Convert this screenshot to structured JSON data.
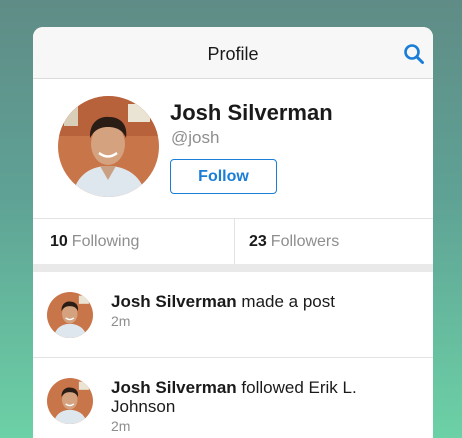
{
  "header": {
    "title": "Profile",
    "search_icon": "search-icon"
  },
  "profile": {
    "name": "Josh Silverman",
    "handle": "@josh",
    "follow_label": "Follow",
    "avatar": "profile-photo"
  },
  "stats": {
    "following_count": "10",
    "following_label": "Following",
    "followers_count": "23",
    "followers_label": "Followers"
  },
  "feed": [
    {
      "actor": "Josh Silverman",
      "action": "made a post",
      "time": "2m"
    },
    {
      "actor": "Josh Silverman",
      "action": "followed Erik L. Johnson",
      "time": "2m"
    }
  ],
  "colors": {
    "accent": "#1a7ed6",
    "text_muted": "#8e8e8e",
    "background_top": "#5f8c86",
    "background_bottom": "#6cd1a6"
  }
}
